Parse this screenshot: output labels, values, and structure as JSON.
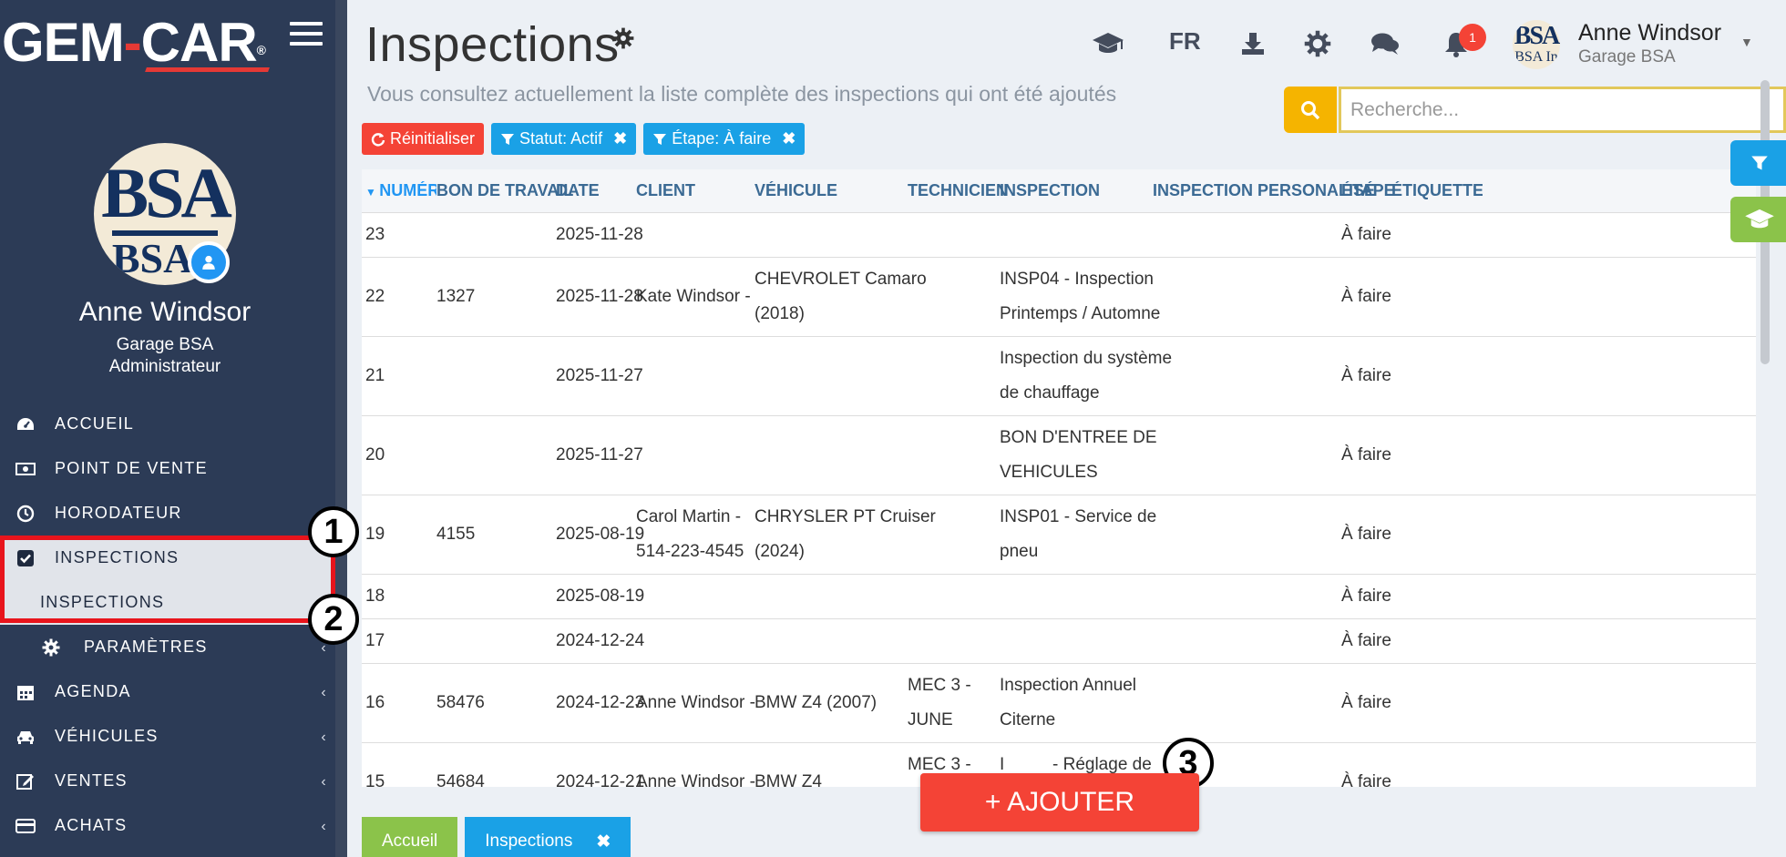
{
  "brand": {
    "logo_left": "GEM",
    "logo_dash": "-",
    "logo_right": "CAR",
    "logo_reg": "®"
  },
  "sidebar": {
    "user_name": "Anne Windsor",
    "garage": "Garage BSA",
    "role": "Administrateur",
    "avatar_text_top": "BSA",
    "avatar_text_bottom": "BSA I",
    "items": [
      {
        "label": "ACCUEIL",
        "icon": "dashboard-icon"
      },
      {
        "label": "POINT DE VENTE",
        "icon": "cash-icon"
      },
      {
        "label": "HORODATEUR",
        "icon": "clock-icon"
      },
      {
        "label": "INSPECTIONS",
        "icon": "checkbox-icon"
      },
      {
        "label": "INSPECTIONS",
        "icon": ""
      },
      {
        "label": "PARAMÈTRES",
        "icon": "gear-icon"
      },
      {
        "label": "AGENDA",
        "icon": "calendar-icon"
      },
      {
        "label": "VÉHICULES",
        "icon": "car-icon"
      },
      {
        "label": "VENTES",
        "icon": "edit-icon"
      },
      {
        "label": "ACHATS",
        "icon": "credit-card-icon"
      }
    ]
  },
  "callouts": {
    "one": "1",
    "two": "2",
    "three": "3"
  },
  "header": {
    "title": "Inspections",
    "subtitle": "Vous consultez actuellement la liste complète des inspections qui ont été ajoutés",
    "language": "FR",
    "notification_count": "1",
    "user_name": "Anne Windsor",
    "user_garage": "Garage BSA",
    "user_logo_top": "BSA",
    "user_logo_bottom": "BSA In"
  },
  "search": {
    "placeholder": "Recherche..."
  },
  "filters": {
    "reset_label": "Réinitialiser",
    "status_label": "Statut: Actif",
    "step_label": "Étape: À faire"
  },
  "table": {
    "columns": [
      "NUMÉRO",
      "BON DE TRAVAIL",
      "DATE",
      "CLIENT",
      "VÉHICULE",
      "TECHNICIEN",
      "INSPECTION",
      "INSPECTION PERSONALISÉ",
      "ÉTAPE",
      "ÉTIQUETTES"
    ],
    "rows": [
      {
        "num": "23",
        "work_order": "",
        "date": "2025-11-28",
        "client1": "",
        "client2": "",
        "vehicle1": "",
        "vehicle2": "",
        "tech1": "",
        "tech2": "",
        "insp1": "",
        "insp2": "",
        "step": "À faire"
      },
      {
        "num": "22",
        "work_order": "1327",
        "date": "2025-11-28",
        "client1": "Kate Windsor -",
        "client2": "",
        "vehicle1": "CHEVROLET Camaro",
        "vehicle2": "(2018)",
        "tech1": "",
        "tech2": "",
        "insp1": "INSP04 - Inspection",
        "insp2": "Printemps / Automne",
        "step": "À faire"
      },
      {
        "num": "21",
        "work_order": "",
        "date": "2025-11-27",
        "client1": "",
        "client2": "",
        "vehicle1": "",
        "vehicle2": "",
        "tech1": "",
        "tech2": "",
        "insp1": "Inspection du système",
        "insp2": "de chauffage",
        "step": "À faire"
      },
      {
        "num": "20",
        "work_order": "",
        "date": "2025-11-27",
        "client1": "",
        "client2": "",
        "vehicle1": "",
        "vehicle2": "",
        "tech1": "",
        "tech2": "",
        "insp1": "BON D'ENTREE DE",
        "insp2": "VEHICULES",
        "step": "À faire"
      },
      {
        "num": "19",
        "work_order": "4155",
        "date": "2025-08-19",
        "client1": "Carol Martin -",
        "client2": "514-223-4545",
        "vehicle1": "CHRYSLER PT Cruiser",
        "vehicle2": "(2024)",
        "tech1": "",
        "tech2": "",
        "insp1": "INSP01 - Service de",
        "insp2": "pneu",
        "step": "À faire"
      },
      {
        "num": "18",
        "work_order": "",
        "date": "2025-08-19",
        "client1": "",
        "client2": "",
        "vehicle1": "",
        "vehicle2": "",
        "tech1": "",
        "tech2": "",
        "insp1": "",
        "insp2": "",
        "step": "À faire"
      },
      {
        "num": "17",
        "work_order": "",
        "date": "2024-12-24",
        "client1": "",
        "client2": "",
        "vehicle1": "",
        "vehicle2": "",
        "tech1": "",
        "tech2": "",
        "insp1": "",
        "insp2": "",
        "step": "À faire"
      },
      {
        "num": "16",
        "work_order": "58476",
        "date": "2024-12-23",
        "client1": "Anne Windsor -",
        "client2": "",
        "vehicle1": "BMW Z4 (2007)",
        "vehicle2": "",
        "tech1": "MEC 3 -",
        "tech2": "JUNE",
        "insp1": "Inspection Annuel",
        "insp2": "Citerne",
        "step": "À faire"
      },
      {
        "num": "15",
        "work_order": "54684",
        "date": "2024-12-21",
        "client1": "Anne Windsor -",
        "client2": "",
        "vehicle1": "BMW Z4",
        "vehicle2": "",
        "tech1": "MEC 3 -",
        "tech2": "",
        "insp1": "I",
        "insp1b": "- Réglage de",
        "insp2": "",
        "step": "À faire"
      }
    ]
  },
  "add_button": {
    "label": "+ AJOUTER"
  },
  "bottom_tabs": {
    "home": "Accueil",
    "inspections": "Inspections",
    "close": "✖"
  },
  "colors": {
    "sidebar": "#2c3b56",
    "accent_red": "#f44336",
    "accent_blue": "#1aa1e6",
    "search_yellow": "#f5b400",
    "green": "#8bc34a",
    "highlight": "#e8141c"
  }
}
